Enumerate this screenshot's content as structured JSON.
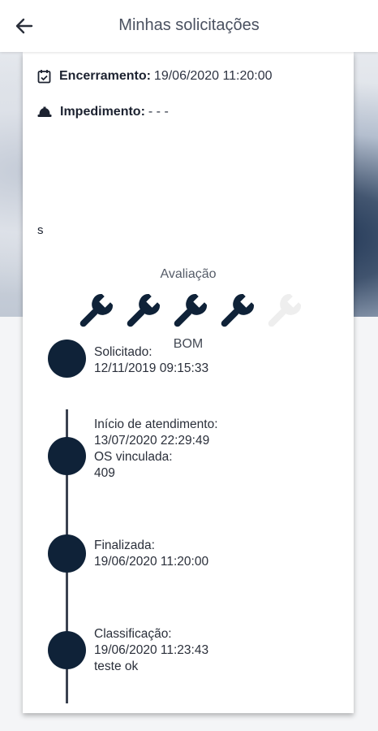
{
  "header": {
    "title": "Minhas solicitações",
    "back_icon": "arrow-left-icon"
  },
  "details": {
    "closing": {
      "icon": "calendar-check-icon",
      "label": "Encerramento:",
      "value": "19/06/2020 11:20:00"
    },
    "impediment": {
      "icon": "hard-hat-icon",
      "label": "Impedimento:",
      "value": "- - -"
    },
    "description": "s"
  },
  "rating": {
    "title": "Avaliação",
    "score": 4,
    "max": 5,
    "icon": "wrench-icon",
    "label": "BOM",
    "active_color": "#0f2238",
    "inactive_color": "#eeeeee"
  },
  "timeline": [
    {
      "lines": [
        "Solicitado:",
        "12/11/2019 09:15:33"
      ]
    },
    {
      "lines": [
        "Início de atendimento:",
        "13/07/2020 22:29:49",
        "OS vinculada:",
        "409"
      ]
    },
    {
      "lines": [
        "Finalizada:",
        "19/06/2020 11:20:00"
      ]
    },
    {
      "lines": [
        "Classificação:",
        "19/06/2020 11:23:43",
        "teste ok"
      ]
    }
  ]
}
